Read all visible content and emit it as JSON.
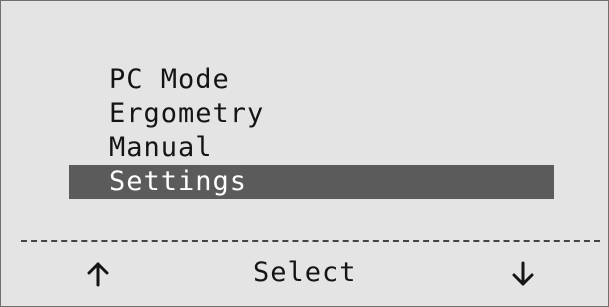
{
  "menu": {
    "items": [
      {
        "label": "PC Mode",
        "selected": false
      },
      {
        "label": "Ergometry",
        "selected": false
      },
      {
        "label": "Manual",
        "selected": false
      },
      {
        "label": "Settings",
        "selected": true
      }
    ]
  },
  "softkeys": {
    "left_icon": "arrow-up-icon",
    "center_label": "Select",
    "right_icon": "arrow-down-icon"
  },
  "colors": {
    "screen_background": "#e4e4e4",
    "selection_background": "#5b5b5b",
    "selection_text": "#ffffff",
    "text": "#141414"
  }
}
